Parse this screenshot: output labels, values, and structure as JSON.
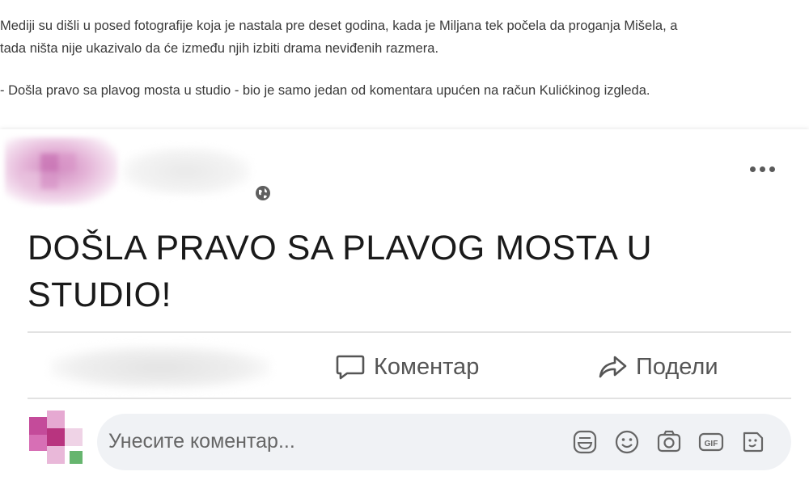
{
  "article": {
    "line1": "Mediji su dišli u posed fotografije koja je nastala pre deset godina, kada je Miljana tek počela da proganja Mišela, a",
    "line2": "tada ništa nije ukazivalo da će između njih izbiti drama neviđenih razmera.",
    "line3": "- Došla pravo sa plavog mosta u studio - bio je samo jedan od komentara upućen na račun Kulićkinog izgleda."
  },
  "post": {
    "text_line1": "DOŠLA PRAVO SA PLAVOG MOSTA U",
    "text_line2": "STUDIO!",
    "privacy_icon": "globe-icon",
    "more_icon": "more-options-icon"
  },
  "actions": {
    "comment_label": "Коментар",
    "comment_icon": "speech-bubble-icon",
    "share_label": "Подели",
    "share_icon": "share-arrow-icon"
  },
  "composer": {
    "placeholder": "Унесите коментар...",
    "icons": [
      "sticker-icon",
      "emoji-icon",
      "camera-icon",
      "gif-icon",
      "avatar-sticker-icon"
    ]
  },
  "colors": {
    "avatar_pink": "#d08cc0",
    "comment_box_bg": "#f0f2f5",
    "icon_gray": "#5a5a5a"
  }
}
